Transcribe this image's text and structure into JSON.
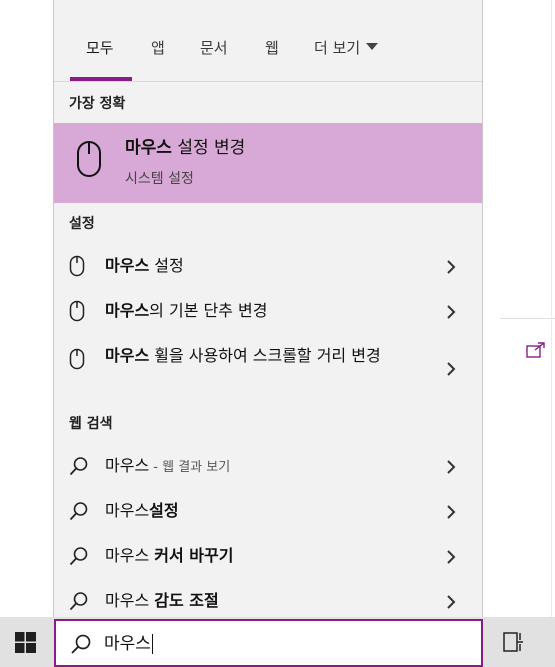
{
  "tabs": [
    {
      "label": "모두"
    },
    {
      "label": "앱"
    },
    {
      "label": "문서"
    },
    {
      "label": "웹"
    },
    {
      "label": "더 보기"
    }
  ],
  "best_match": {
    "section": "가장 정확",
    "title_bold": "마우스",
    "title_rest": " 설정 변경",
    "subtitle": "시스템 설정"
  },
  "settings": {
    "section": "설정",
    "items": [
      {
        "bold": "마우스",
        "rest": " 설정"
      },
      {
        "bold": "마우스",
        "rest": "의 기본 단추 변경"
      },
      {
        "bold": "마우스",
        "rest": " 휠을 사용하여 스크롤할 거리 변경"
      }
    ]
  },
  "web": {
    "section": "웹 검색",
    "items": [
      {
        "normal": "마우스",
        "muted": " - 웹 결과 보기",
        "bold": ""
      },
      {
        "normal": "마우스",
        "bold": "설정"
      },
      {
        "normal": "마우스 ",
        "bold": "커서 바꾸기"
      },
      {
        "normal": "마우스 ",
        "bold": "감도 조절"
      }
    ]
  },
  "search": {
    "value": "마우스"
  },
  "colors": {
    "accent": "#8a1c8a",
    "selected_bg": "#d8a9d6",
    "panel_bg": "#f2f2f2"
  },
  "icons": [
    "mouse-icon",
    "search-icon",
    "chevron-right-icon",
    "windows-logo-icon",
    "task-view-icon",
    "open-external-icon"
  ]
}
